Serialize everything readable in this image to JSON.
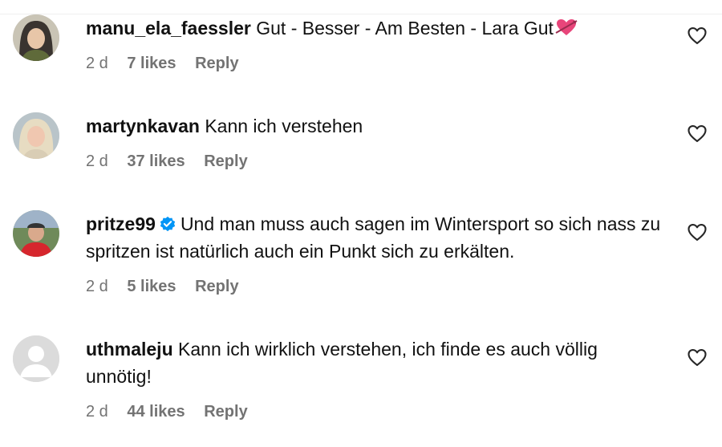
{
  "comments": [
    {
      "username": "manu_ela_faessler",
      "text": "Gut - Besser - Am Besten - Lara Gut",
      "emoji": "heart-with-arrow",
      "verified": false,
      "time": "2 d",
      "likes": "7 likes",
      "reply": "Reply"
    },
    {
      "username": "martynkavan",
      "text": "Kann ich verstehen",
      "verified": false,
      "time": "2 d",
      "likes": "37 likes",
      "reply": "Reply"
    },
    {
      "username": "pritze99",
      "text": "Und man muss auch sagen im Wintersport so sich nass zu spritzen ist natürlich auch ein Punkt sich zu erkälten.",
      "verified": true,
      "time": "2 d",
      "likes": "5 likes",
      "reply": "Reply"
    },
    {
      "username": "uthmaleju",
      "text": "Kann ich wirklich verstehen, ich finde es auch völlig unnötig!",
      "verified": false,
      "time": "2 d",
      "likes": "44 likes",
      "reply": "Reply"
    }
  ],
  "colors": {
    "text": "#111111",
    "meta": "#737373",
    "verified": "#0095f6",
    "emoji": "#e8457a"
  },
  "icons": {
    "like": "heart-outline-icon",
    "verified": "verified-badge-icon",
    "default_avatar": "default-avatar-icon"
  }
}
